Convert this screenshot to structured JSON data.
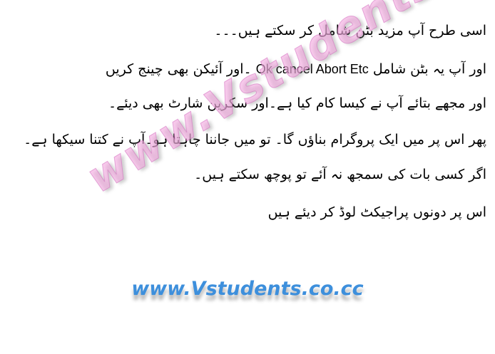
{
  "document": {
    "lines": [
      {
        "text": "اسی طرح آپ مزید بٹن شامل کر سکتے ہیں۔۔۔"
      },
      {
        "before": "اور آپ یہ بٹن شامل",
        "latin": "Ok cancel Abort Etc",
        "after": "۔اور آئیکن بھی چینج کریں"
      },
      {
        "text": "اور مجھے بتائے آپ نے کیسا کام کیا ہے۔اور سکرین شارٹ بھی دیئے۔"
      },
      {
        "text": "پھر اس پر میں ایک پروگرام بناؤں گا۔ تو میں جاننا چاہتا ہو۔آپ نے کتنا سیکھا ہے۔"
      },
      {
        "text": "اگر کسی بات کی سمجھ نہ آئے تو پوچھ سکتے ہیں۔"
      },
      {
        "text": "اس پر دونوں پراجیکٹ لوڈ کر دیئے ہیں"
      }
    ]
  },
  "watermark": {
    "text": "www.Vstudents.co.cc",
    "color": "#f4aae1"
  },
  "footer": {
    "link_text": "www.Vstudents.co.cc",
    "color": "#3d8fdc"
  }
}
